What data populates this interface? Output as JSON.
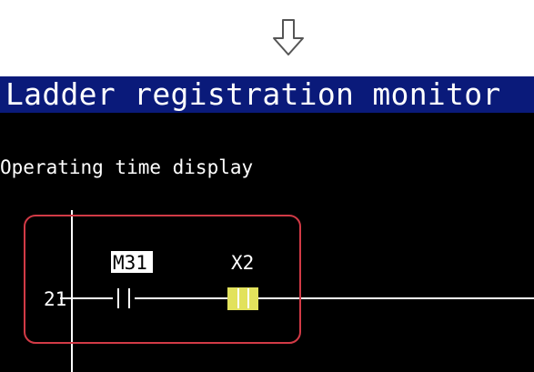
{
  "instruction_arrow": {
    "icon": "down-arrow-icon"
  },
  "screen": {
    "title": "Ladder registration monitor",
    "subtitle": "Operating time display",
    "colors": {
      "title_bar": "#0a1a7a",
      "background": "#000000",
      "text": "#ffffff",
      "highlight_box": "#d23a46",
      "contact_highlight": "#e2e25c"
    },
    "ladder": {
      "step_number": "21",
      "contacts": [
        {
          "label": "M31",
          "highlighted": false,
          "label_inverted": true
        },
        {
          "label": "X2",
          "highlighted": true,
          "label_inverted": false
        }
      ]
    }
  }
}
